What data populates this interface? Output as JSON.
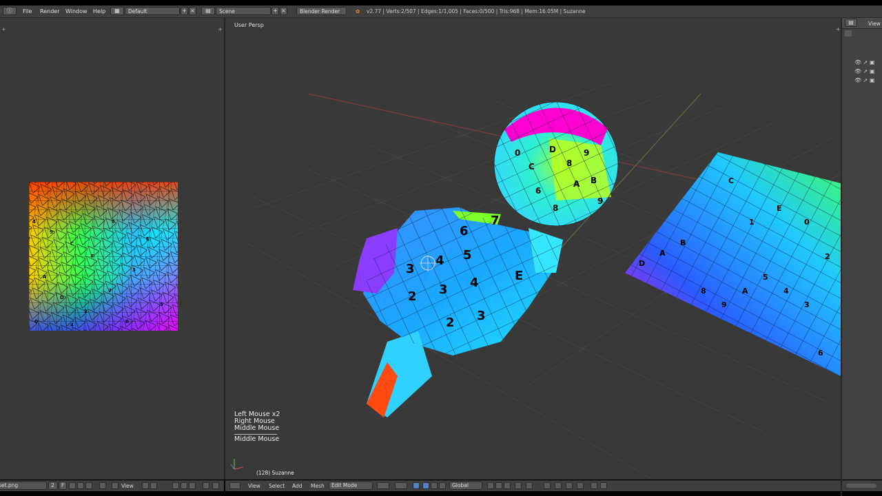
{
  "info_header": {
    "menus": [
      "File",
      "Render",
      "Window",
      "Help"
    ],
    "screen_layout": "Default",
    "scene": "Scene",
    "render_engine": "Blender Render",
    "stats": "v2.77 | Verts:2/507 | Edges:1/1,005 | Faces:0/500 | Tris:968 | Mem:16.05M | Suzanne"
  },
  "uv_editor": {
    "image_name": "set.png",
    "users": "2",
    "fake_user": "F",
    "view_menu": "View"
  },
  "viewport": {
    "view_label": "User Persp",
    "object_info": "(128) Suzanne",
    "key_hints": [
      "Left Mouse x2",
      "Right Mouse",
      "Middle Mouse",
      "Middle Mouse"
    ],
    "header": {
      "menus": [
        "View",
        "Select",
        "Add",
        "Mesh"
      ],
      "mode": "Edit Mode",
      "orientation": "Global"
    }
  },
  "outliner": {
    "view_menu": "View"
  },
  "colors": {
    "panel_bg": "#393939",
    "header_bg": "#3f3f3f",
    "grid_red": "#8a3a3a",
    "grid_green": "#5c7a3a"
  }
}
